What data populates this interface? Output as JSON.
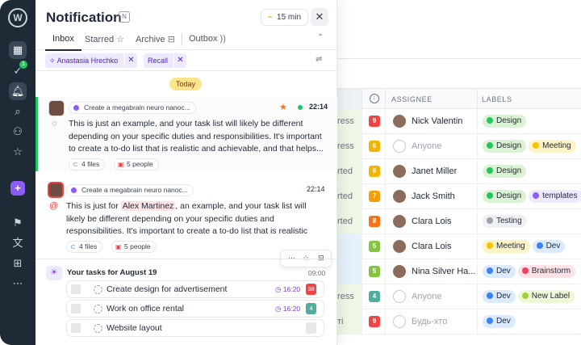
{
  "panel": {
    "title": "Notification",
    "badge": "N",
    "timer": "15 min",
    "tabs": [
      {
        "label": "Inbox",
        "active": true
      },
      {
        "label": "Starred"
      },
      {
        "label": "Archive"
      },
      {
        "label": "Outbox"
      }
    ],
    "filters": [
      "Anastasia Hrechko",
      "Recall"
    ],
    "date_divider": "Today",
    "notifications": [
      {
        "source": "Create a megabrain neuro nanoc...",
        "time": "22:14",
        "starred": true,
        "body": "This is just an example, and your task list will likely be different depending on your specific duties and responsibilities. It's important to create a to-do list that is realistic and achievable, and that helps...",
        "files": "4 files",
        "people": "5 people"
      },
      {
        "source": "Create a megabrain neuro nanoc...",
        "time": "22:14",
        "body_before": "This is just for ",
        "mention": "Alex Martinez",
        "body_after": ", an example, and your task list will likely be different depending on your specific duties and responsibilities. It's important to create a to-do list that is realistic and achievable, and that helps...",
        "files": "4 files",
        "people": "5 people"
      }
    ],
    "tasks_block": {
      "title": "Your tasks for August 19",
      "time": "09:00",
      "tasks": [
        {
          "title": "Create design for advertisement",
          "time": "16:20",
          "badge": "38",
          "badge_color": "#ef4444"
        },
        {
          "title": "Work on office rental",
          "time": "16:20",
          "badge": "4",
          "badge_color": "#4fae9c"
        },
        {
          "title": "Website layout",
          "time": "",
          "badge": "",
          "badge_color": "#e5e7eb"
        }
      ]
    }
  },
  "rail": {
    "notification_count": "1"
  },
  "table": {
    "headers": {
      "assignee": "ASSIGNEE",
      "labels": "LABELS"
    },
    "rows": [
      {
        "status": "ress",
        "priority": "9",
        "pcolor": "#ef4444",
        "assignee": "Nick Valentin",
        "empty": false,
        "labels": [
          {
            "t": "Design",
            "c": "#22c55e",
            "bg": "#dcf2d5"
          }
        ]
      },
      {
        "status": "ress",
        "priority": "6",
        "pcolor": "#f5b400",
        "assignee": "Anyone",
        "empty": true,
        "labels": [
          {
            "t": "Design",
            "c": "#22c55e",
            "bg": "#dcf2d5"
          },
          {
            "t": "Meeting",
            "c": "#f5c400",
            "bg": "#fdf3c7"
          }
        ]
      },
      {
        "status": "rted",
        "priority": "6",
        "pcolor": "#f5b400",
        "assignee": "Janet Miller",
        "empty": false,
        "labels": [
          {
            "t": "Design",
            "c": "#22c55e",
            "bg": "#dcf2d5"
          }
        ]
      },
      {
        "status": "rted",
        "priority": "7",
        "pcolor": "#f59e0b",
        "assignee": "Jack Smith",
        "empty": false,
        "labels": [
          {
            "t": "Design",
            "c": "#22c55e",
            "bg": "#dcf2d5"
          },
          {
            "t": "templates",
            "c": "#8b5cf6",
            "bg": "#ede9fe"
          }
        ]
      },
      {
        "status": "rted",
        "priority": "8",
        "pcolor": "#f97316",
        "assignee": "Clara Lois",
        "empty": false,
        "labels": [
          {
            "t": "Testing",
            "c": "#9ca3af",
            "bg": "#eef0f3"
          }
        ]
      },
      {
        "status": "",
        "priority": "5",
        "pcolor": "#84c440",
        "assignee": "Clara Lois",
        "empty": false,
        "labels": [
          {
            "t": "Meeting",
            "c": "#f5c400",
            "bg": "#fdf3c7"
          },
          {
            "t": "Dev",
            "c": "#3b82f6",
            "bg": "#dbeafe"
          }
        ]
      },
      {
        "status": "",
        "priority": "5",
        "pcolor": "#84c440",
        "assignee": "Nina Silver Ha...",
        "empty": false,
        "labels": [
          {
            "t": "Dev",
            "c": "#3b82f6",
            "bg": "#dbeafe"
          },
          {
            "t": "Brainstorm",
            "c": "#f43f5e",
            "bg": "#fde2e6"
          }
        ]
      },
      {
        "status": "ress",
        "priority": "4",
        "pcolor": "#4fae9c",
        "assignee": "Anyone",
        "empty": true,
        "labels": [
          {
            "t": "Dev",
            "c": "#3b82f6",
            "bg": "#dbeafe"
          },
          {
            "t": "New Label",
            "c": "#a3d039",
            "bg": "#eef7d6"
          }
        ]
      },
      {
        "status": "ті",
        "priority": "9",
        "pcolor": "#ef4444",
        "assignee": "Будь-хто",
        "empty": true,
        "labels": [
          {
            "t": "Dev",
            "c": "#3b82f6",
            "bg": "#dbeafe"
          }
        ]
      }
    ]
  }
}
